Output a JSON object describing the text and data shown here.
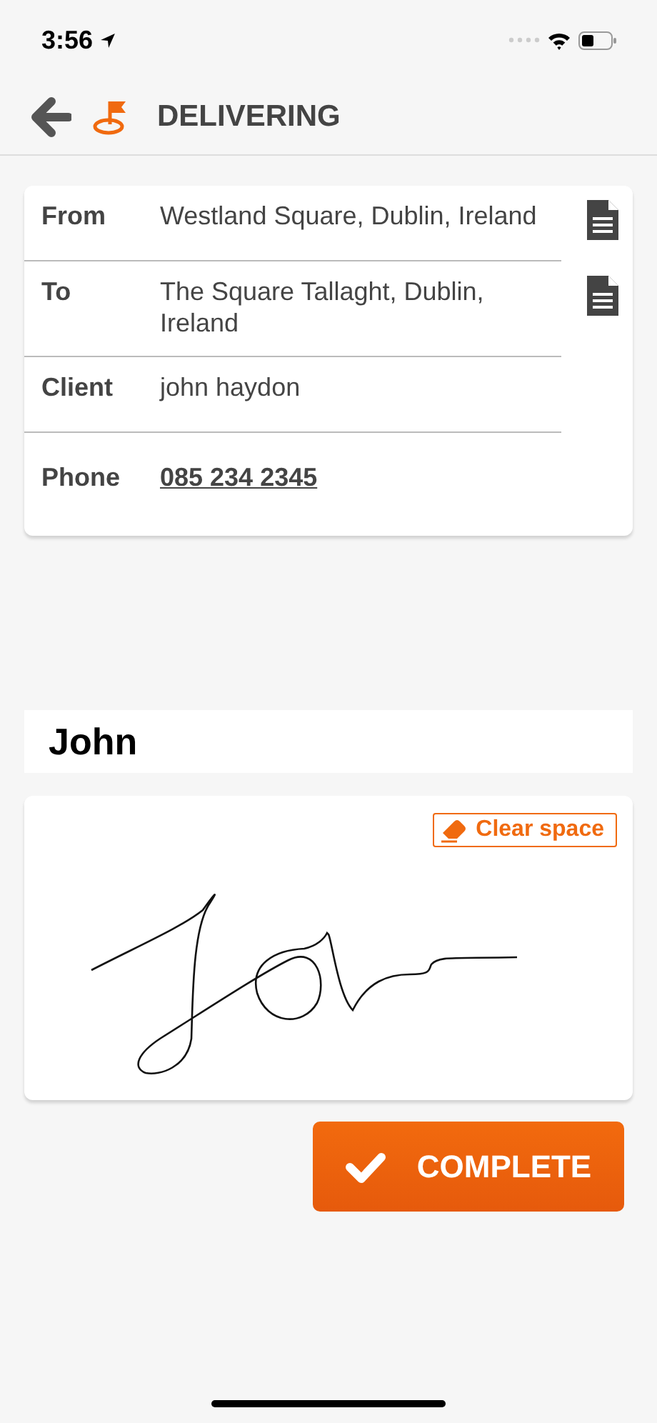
{
  "status_bar": {
    "time": "3:56"
  },
  "header": {
    "title": "DELIVERING"
  },
  "details": [
    {
      "label": "From",
      "value": "Westland Square, Dublin, Ireland",
      "kind": "document"
    },
    {
      "label": "To",
      "value": "The Square Tallaght, Dublin, Ireland",
      "kind": "document"
    },
    {
      "label": "Client",
      "value": "john haydon",
      "kind": "text"
    },
    {
      "label": "Phone",
      "value": "085 234 2345",
      "kind": "link"
    }
  ],
  "name_field": {
    "value": "John"
  },
  "signature": {
    "clear_button": "Clear space"
  },
  "complete_button": "COMPLETE"
}
